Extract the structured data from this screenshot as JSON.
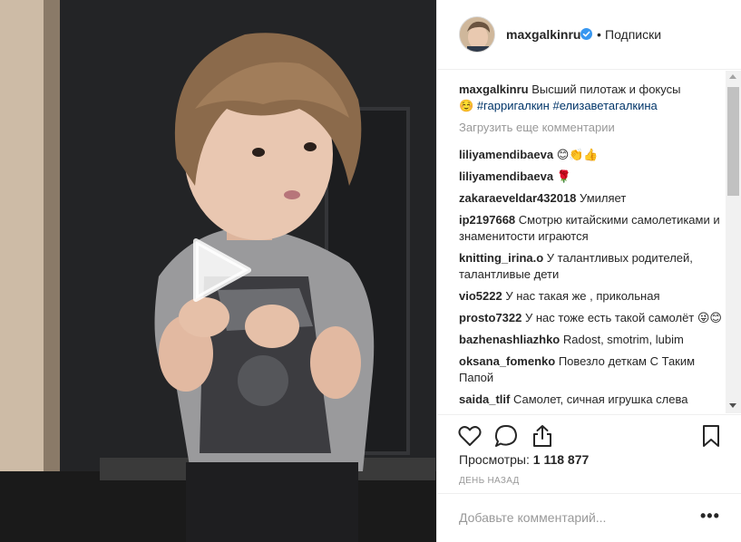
{
  "header": {
    "username": "maxgalkinru",
    "separator": "•",
    "follow_label": "Подписки"
  },
  "caption": {
    "username": "maxgalkinru",
    "text": "Высший пилотаж и фокусы",
    "emoji": "☺️",
    "tags": [
      "#гарригалкин",
      "#елизаветагалкина"
    ]
  },
  "load_more_label": "Загрузить еще комментарии",
  "comments": [
    {
      "user": "liliyamendibaeva",
      "text": "😊👏👍"
    },
    {
      "user": "liliyamendibaeva",
      "text": "🌹"
    },
    {
      "user": "zakaraeveldar432018",
      "text": "Умиляет"
    },
    {
      "user": "ip2197668",
      "text": "Смотрю китайскими самолетиками и знаменитости играются"
    },
    {
      "user": "knitting_irina.o",
      "text": "У талантливых родителей, талантливые дети"
    },
    {
      "user": "vio5222",
      "text": "У нас такая же , прикольная"
    },
    {
      "user": "prosto7322",
      "text": "У нас тоже есть такой самолёт 😜😊"
    },
    {
      "user": "bazhenashliazhko",
      "text": "Radost, smotrim, lubim"
    },
    {
      "user": "oksana_fomenko",
      "text": "Повезло деткам С Таким Папой"
    },
    {
      "user": "saida_tlif",
      "text": "Самолет, сичная игрушка слева"
    }
  ],
  "stats": {
    "views_label": "Просмотры:",
    "views_value": "1 118 877",
    "time_label": "день назад"
  },
  "add_comment": {
    "placeholder": "Добавьте комментарий..."
  },
  "icons": {
    "verified": "verified-badge-icon",
    "like": "heart-icon",
    "comment": "comment-bubble-icon",
    "share": "share-icon",
    "save": "bookmark-icon",
    "more": "more-dots-icon",
    "play": "play-icon"
  },
  "colors": {
    "accent_link": "#003569",
    "verified_blue": "#3897f0",
    "muted": "#999999",
    "border": "#efefef"
  }
}
